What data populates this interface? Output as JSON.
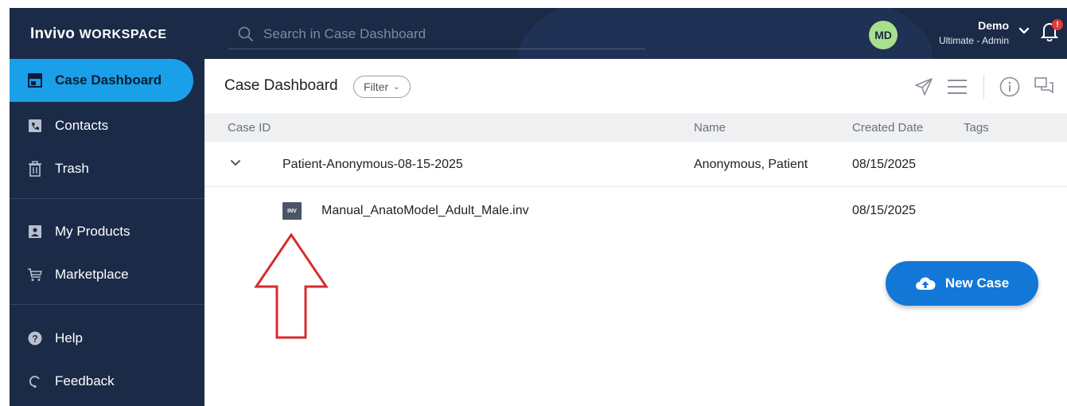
{
  "app": {
    "logo_brand": "Invivo",
    "logo_suffix": "WORKSPACE"
  },
  "search": {
    "placeholder": "Search in Case Dashboard",
    "value": ""
  },
  "user": {
    "initials": "MD",
    "name": "Demo",
    "role": "Ultimate - Admin",
    "notification_badge": "!"
  },
  "sidebar": {
    "items": [
      {
        "label": "Case Dashboard",
        "icon": "dashboard-icon",
        "active": true
      },
      {
        "label": "Contacts",
        "icon": "contacts-icon",
        "active": false
      },
      {
        "label": "Trash",
        "icon": "trash-icon",
        "active": false
      },
      {
        "label": "My Products",
        "icon": "products-icon",
        "active": false
      },
      {
        "label": "Marketplace",
        "icon": "cart-icon",
        "active": false
      },
      {
        "label": "Help",
        "icon": "help-icon",
        "active": false
      },
      {
        "label": "Feedback",
        "icon": "feedback-icon",
        "active": false
      }
    ]
  },
  "main": {
    "title": "Case Dashboard",
    "filter_label": "Filter",
    "table": {
      "columns": [
        "Case ID",
        "Name",
        "Created Date",
        "Tags"
      ],
      "rows": [
        {
          "case_id": "Patient-Anonymous-08-15-2025",
          "name": "Anonymous, Patient",
          "created": "08/15/2025",
          "tags": ""
        },
        {
          "file_badge": "INV",
          "file_name": "Manual_AnatoModel_Adult_Male.inv",
          "created": "08/15/2025"
        }
      ]
    },
    "new_case_label": "New Case"
  },
  "colors": {
    "sidebar_bg": "#1a2a47",
    "active_item": "#1aa0e8",
    "primary_button": "#1277d6",
    "annotation_arrow": "#d92b2b"
  }
}
